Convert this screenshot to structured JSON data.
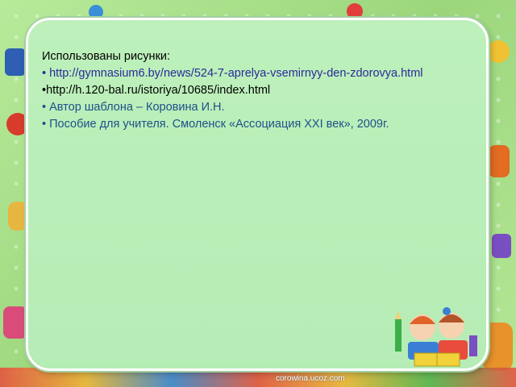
{
  "slide": {
    "heading": "Использованы рисунки:",
    "lines": [
      "• http://gymnasium6.by/news/524-7-aprelya-vsemirnyy-den-zdorovya.html",
      "•http://h.120-bal.ru/istoriya/10685/index.html",
      "• Автор шаблона – Коровина И.Н.",
      "• Пособие для учителя. Смоленск «Ассоциация XXI век», 2009г."
    ],
    "credit": "corowina.ucoz.com"
  },
  "colors": {
    "background": "#a9e08a",
    "panel": "#bdf0bb",
    "link_text": "#2a2a9a",
    "blue_text": "#1f4f8a"
  }
}
